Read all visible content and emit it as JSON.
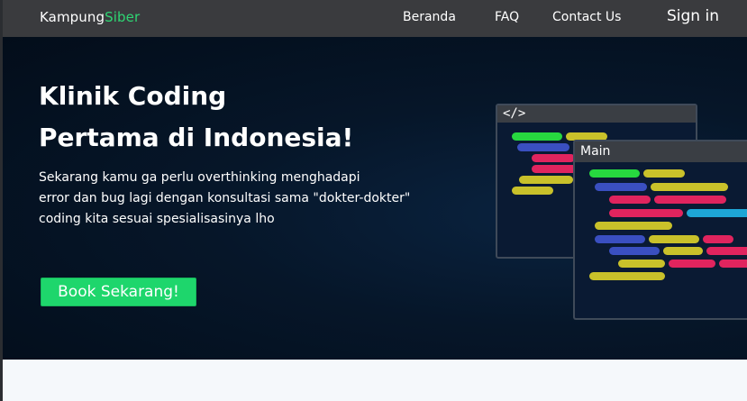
{
  "brand": {
    "name_part1": "Kampung",
    "name_part2": "Siber"
  },
  "nav": {
    "beranda": "Beranda",
    "faq": "FAQ",
    "contact": "Contact Us",
    "signin": "Sign in"
  },
  "hero": {
    "title_line1": "Klinik Coding",
    "title_line2": "Pertama di Indonesia!",
    "desc_line1": "Sekarang kamu ga perlu overthinking menghadapi",
    "desc_line2": "error dan bug lagi dengan konsultasi sama \"dokter-dokter\"",
    "desc_line3": "coding kita sesuai spesialisasinya lho",
    "cta_label": "Book Sekarang!"
  },
  "illustration": {
    "back_window_title": "</>",
    "front_window_title": "Main"
  },
  "colors": {
    "navbar": "#3a3b3e",
    "accent_green": "#2ed573",
    "cta_green": "#1ed66c",
    "hero_bg": "#061629"
  }
}
